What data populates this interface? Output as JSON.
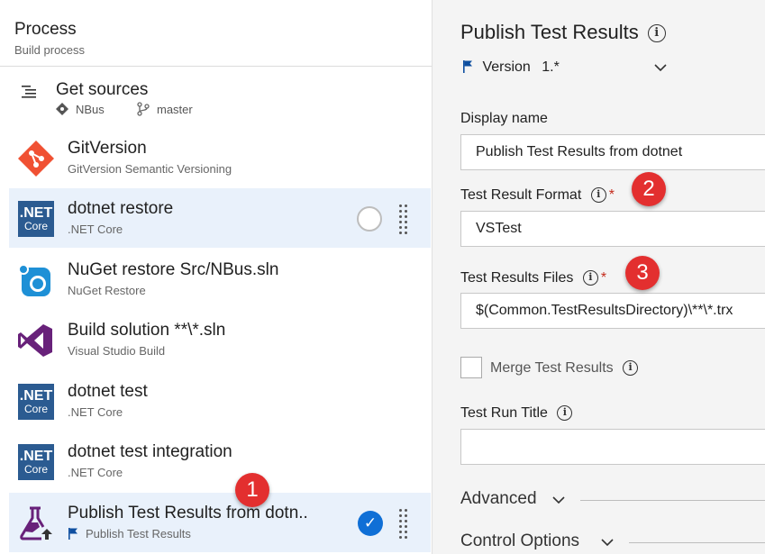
{
  "left": {
    "header": {
      "title": "Process",
      "subtitle": "Build process"
    },
    "get_sources": {
      "label": "Get sources",
      "repo": "NBus",
      "branch": "master"
    },
    "tasks": [
      {
        "name": "GitVersion",
        "sub": "GitVersion Semantic Versioning",
        "icon": "gitversion-icon"
      },
      {
        "name": "dotnet restore",
        "sub": ".NET Core",
        "icon": "dotnet-core-icon"
      },
      {
        "name": "NuGet restore Src/NBus.sln",
        "sub": "NuGet Restore",
        "icon": "nuget-icon"
      },
      {
        "name": "Build solution **\\*.sln",
        "sub": "Visual Studio Build",
        "icon": "visual-studio-icon"
      },
      {
        "name": "dotnet test",
        "sub": ".NET Core",
        "icon": "dotnet-core-icon"
      },
      {
        "name": "dotnet test integration",
        "sub": ".NET Core",
        "icon": "dotnet-core-icon"
      },
      {
        "name": "Publish Test Results from dotn..",
        "sub": "Publish Test Results",
        "icon": "test-flask-icon"
      }
    ],
    "net_icon": {
      "line1": ".NET",
      "line2": "Core"
    },
    "check_glyph": "✓"
  },
  "badges": {
    "b1": "1",
    "b2": "2",
    "b3": "3"
  },
  "right": {
    "title": "Publish Test Results",
    "info_glyph": "i",
    "version_label": "Version",
    "version_value": "1.*",
    "display_name_label": "Display name",
    "display_name_value": "Publish Test Results from dotnet",
    "format_label": "Test Result Format",
    "format_value": "VSTest",
    "files_label": "Test Results Files",
    "files_value": "$(Common.TestResultsDirectory)\\**\\*.trx",
    "merge_label": "Merge Test Results",
    "run_title_label": "Test Run Title",
    "run_title_value": "",
    "required_mark": "*",
    "advanced_label": "Advanced",
    "control_options_label": "Control Options"
  },
  "colors": {
    "accent": "#0f6fd6",
    "selected_bg": "#e9f1fb",
    "badge": "#e32f2f",
    "net_core": "#2b5b91",
    "required": "#c42b1c"
  }
}
